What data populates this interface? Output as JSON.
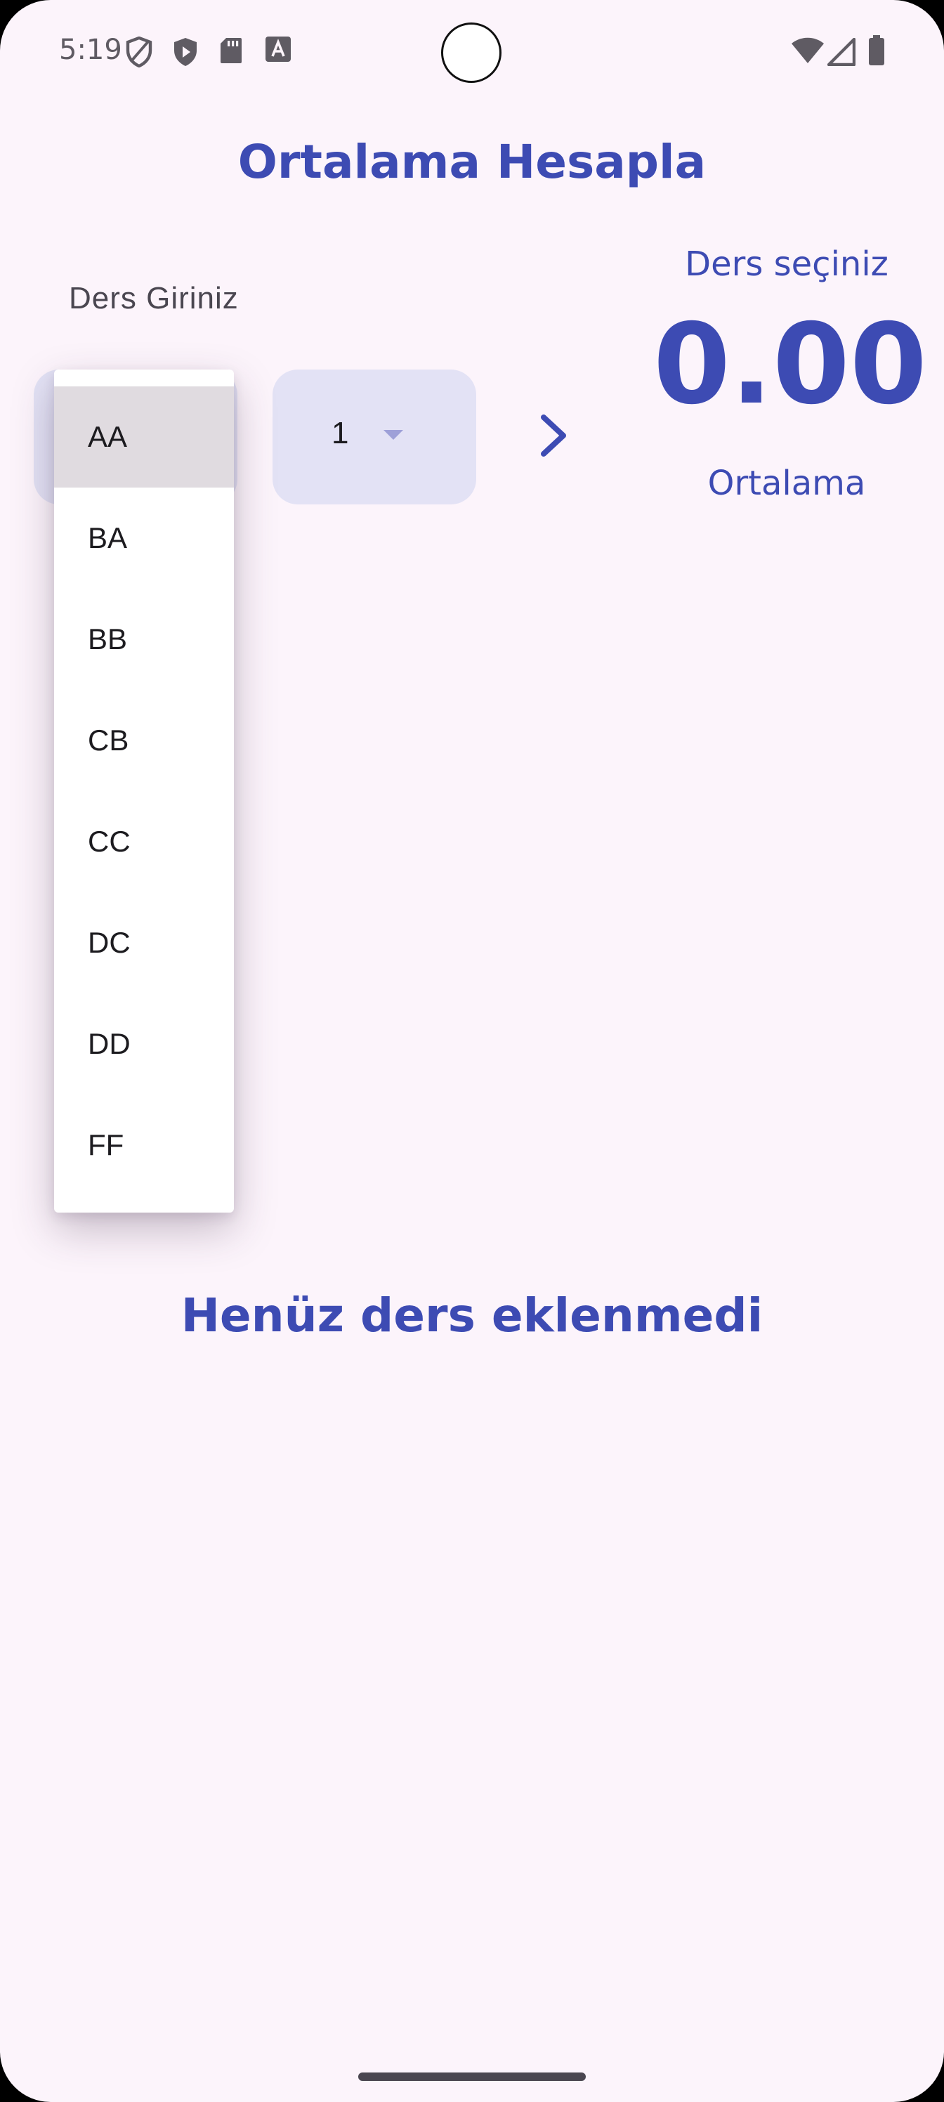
{
  "status_bar": {
    "time": "5:19",
    "left_icons": [
      "shield-outline-icon",
      "shield-play-icon",
      "sd-card-icon",
      "font-a-icon"
    ],
    "right_icons": [
      "wifi-icon",
      "signal-icon",
      "battery-icon"
    ]
  },
  "header": {
    "title": "Ortalama Hesapla"
  },
  "form": {
    "course_label": "Ders Giriniz",
    "credit_value": "1",
    "grade_options": [
      "AA",
      "BA",
      "BB",
      "CB",
      "CC",
      "DC",
      "DD",
      "FF"
    ],
    "selected_grade": "AA"
  },
  "summary": {
    "prompt": "Ders seçiniz",
    "average": "0.00",
    "average_label": "Ortalama"
  },
  "list": {
    "empty_text": "Henüz ders eklenmedi"
  },
  "colors": {
    "accent": "#3d4bb3",
    "background": "#fcf4fb",
    "field_bg": "#e3e2f5",
    "menu_selected": "#e0dbe0"
  }
}
